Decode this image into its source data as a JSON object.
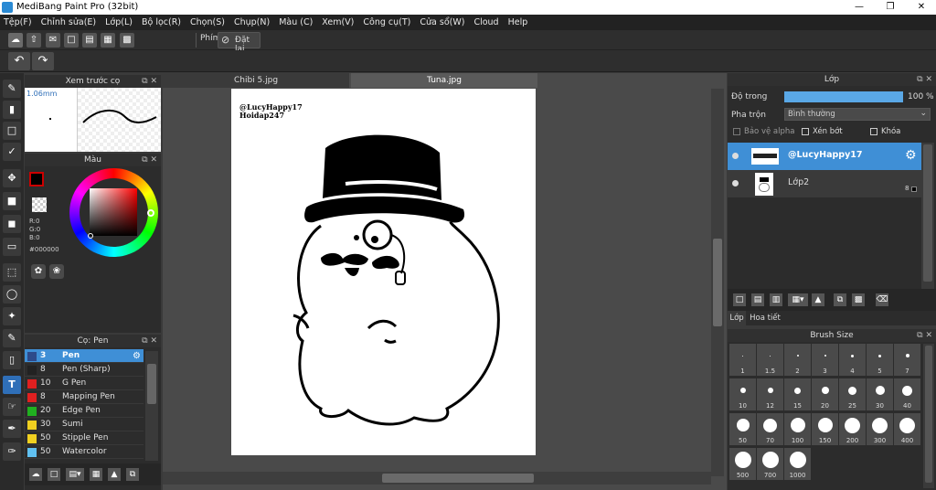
{
  "app": {
    "title": "MediBang Paint Pro (32bit)",
    "window_controls": [
      "—",
      "❐",
      "✕"
    ]
  },
  "menu": [
    "Tệp(F)",
    "Chỉnh sửa(E)",
    "Lớp(L)",
    "Bộ lọc(R)",
    "Chọn(S)",
    "Chụp(N)",
    "Màu (C)",
    "Xem(V)",
    "Công cụ(T)",
    "Cửa sổ(W)",
    "Cloud",
    "Help"
  ],
  "toolbar": {
    "phim_label": "Phím",
    "reset_label": "Đặt lại"
  },
  "preview": {
    "title": "Xem trước cọ",
    "size": "1.06mm"
  },
  "color": {
    "title": "Màu",
    "r": "R:0",
    "g": "G:0",
    "b": "B:0",
    "hex": "#000000",
    "fg": "#000000",
    "bg": "#ffffff",
    "accent": "#3f8fd6"
  },
  "brush_panel": {
    "title": "Cọ: Pen",
    "items": [
      {
        "size": "3",
        "name": "Pen",
        "color": "#2d4a8a",
        "selected": true
      },
      {
        "size": "8",
        "name": "Pen (Sharp)",
        "color": "#222222"
      },
      {
        "size": "10",
        "name": "G Pen",
        "color": "#e02020"
      },
      {
        "size": "8",
        "name": "Mapping Pen",
        "color": "#e02020"
      },
      {
        "size": "20",
        "name": "Edge Pen",
        "color": "#20b020"
      },
      {
        "size": "30",
        "name": "Sumi",
        "color": "#f0d020"
      },
      {
        "size": "50",
        "name": "Stipple Pen",
        "color": "#f0d020"
      },
      {
        "size": "50",
        "name": "Watercolor",
        "color": "#60c0f0"
      }
    ]
  },
  "documents": {
    "tabs": [
      "Chibi 5.jpg",
      "Tuna.jpg"
    ],
    "watermark_line1": "@LucyHappy17",
    "watermark_line2": "Hoidap247"
  },
  "layers": {
    "title": "Lớp",
    "opacity_label": "Độ trong",
    "opacity_value": "100 %",
    "opacity_fraction": 1.0,
    "blend_label": "Pha trộn",
    "blend_value": "Bình thường",
    "protect_alpha": "Bảo vệ alpha",
    "clipping": "Xén bớt",
    "lock": "Khóa",
    "items": [
      {
        "name": "@LucyHappy17",
        "selected": true,
        "bits": ""
      },
      {
        "name": "Lớp2",
        "selected": false,
        "bits": "8"
      }
    ],
    "bottom_tabs": [
      "Lớp",
      "Hoa tiết"
    ]
  },
  "brush_size": {
    "title": "Brush Size",
    "sizes": [
      "1",
      "1.5",
      "2",
      "3",
      "4",
      "5",
      "7",
      "10",
      "12",
      "15",
      "20",
      "25",
      "30",
      "40",
      "50",
      "70",
      "100",
      "150",
      "200",
      "300",
      "400",
      "500",
      "700",
      "1000"
    ]
  }
}
